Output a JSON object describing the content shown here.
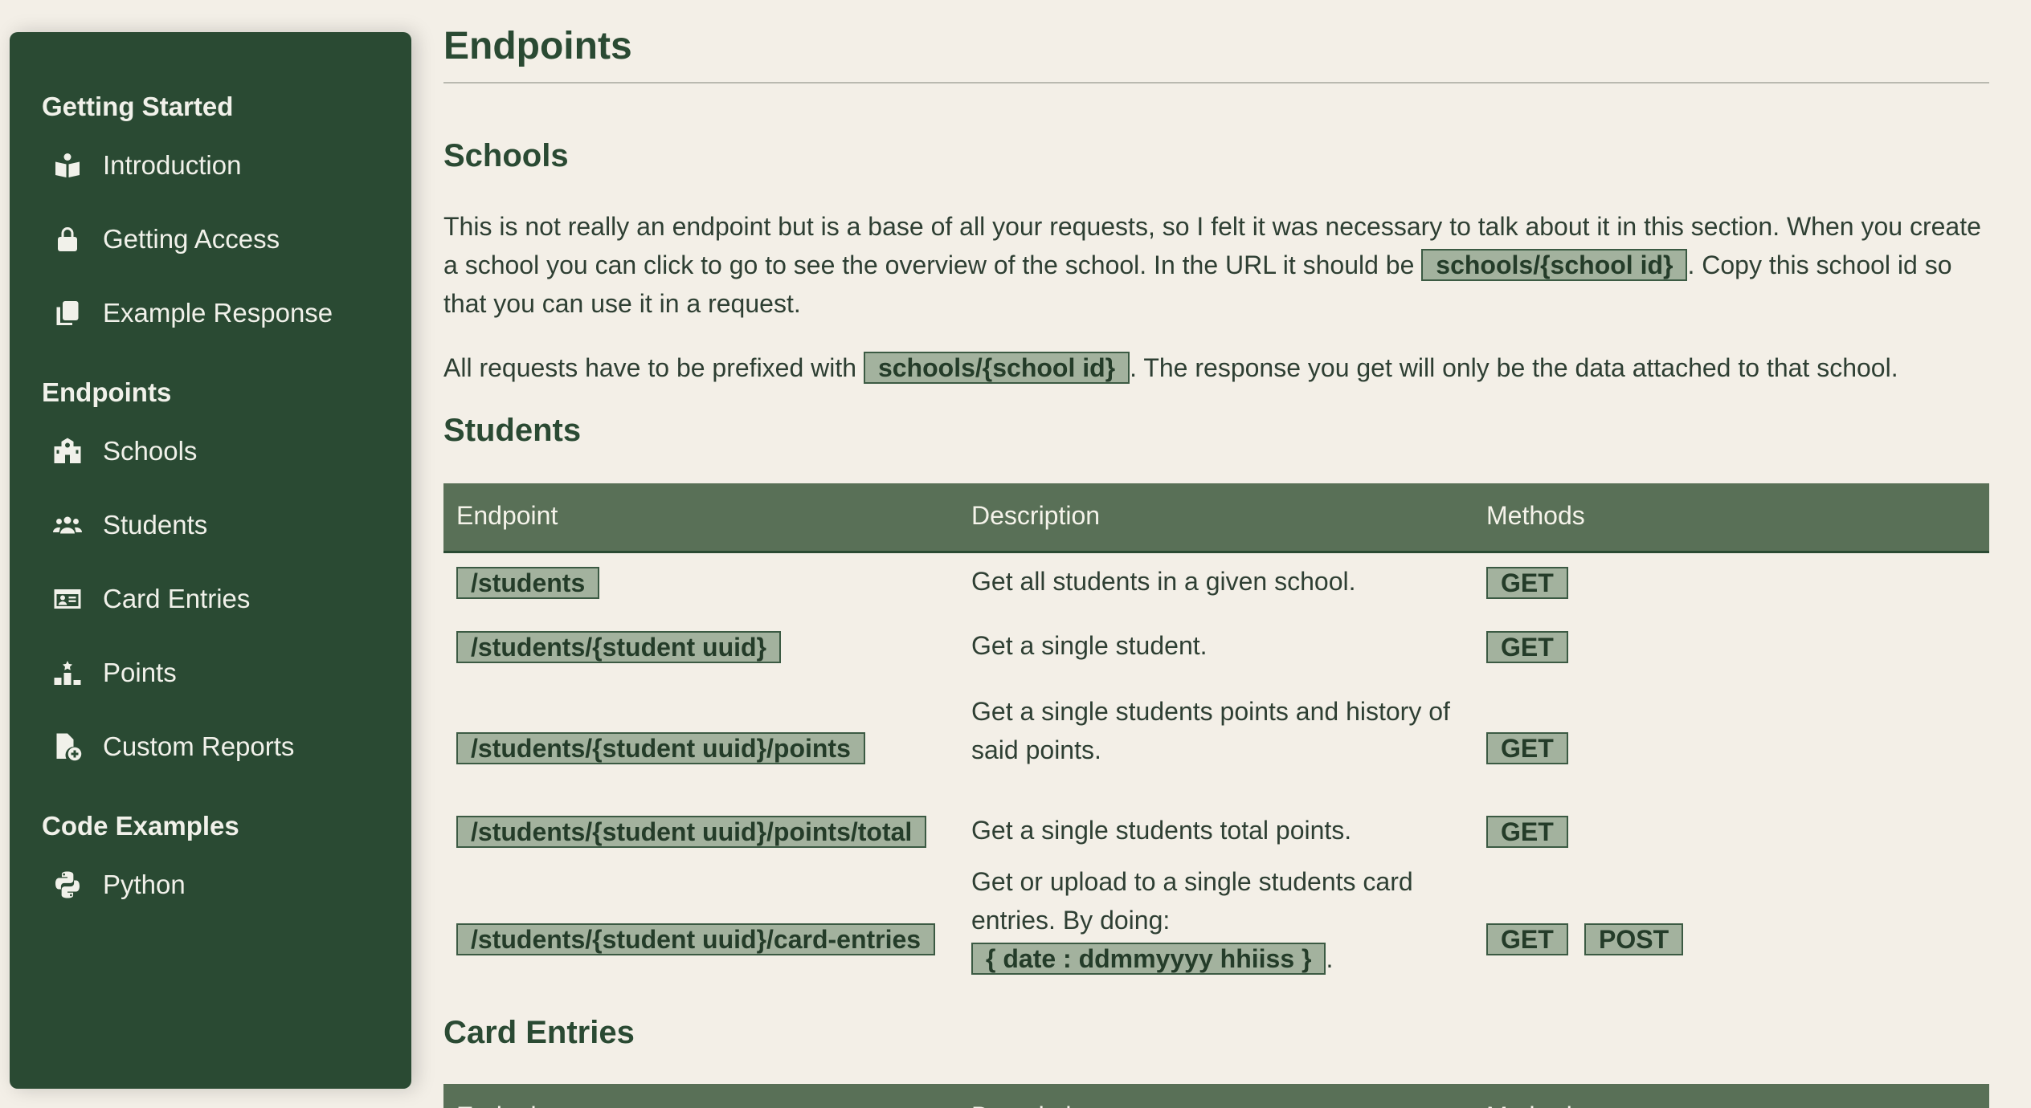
{
  "sidebar": {
    "sections": [
      {
        "title": "Getting Started",
        "items": [
          {
            "label": "Introduction",
            "icon": "book-reader-icon"
          },
          {
            "label": "Getting Access",
            "icon": "lock-icon"
          },
          {
            "label": "Example Response",
            "icon": "copy-icon"
          }
        ]
      },
      {
        "title": "Endpoints",
        "items": [
          {
            "label": "Schools",
            "icon": "school-icon"
          },
          {
            "label": "Students",
            "icon": "users-icon"
          },
          {
            "label": "Card Entries",
            "icon": "id-card-icon"
          },
          {
            "label": "Points",
            "icon": "ranking-icon"
          },
          {
            "label": "Custom Reports",
            "icon": "file-plus-icon"
          }
        ]
      },
      {
        "title": "Code Examples",
        "items": [
          {
            "label": "Python",
            "icon": "python-icon"
          }
        ]
      }
    ]
  },
  "main": {
    "title": "Endpoints",
    "schools": {
      "heading": "Schools",
      "p1_a": "This is not really an endpoint but is a base of all your requests, so I felt it was necessary to talk about it in this section. When you create a school you can click to go to see the overview of the school. In the URL it should be ",
      "p1_code": "schools/{school id}",
      "p1_b": ". Copy this school id so that you can use it in a request.",
      "p2_a": "All requests have to be prefixed with ",
      "p2_code": "schools/{school id}",
      "p2_b": ". The response you get will only be the data attached to that school."
    },
    "students": {
      "heading": "Students",
      "columns": [
        "Endpoint",
        "Description",
        "Methods"
      ],
      "rows": [
        {
          "endpoint": "/students",
          "description": "Get all students in a given school.",
          "methods": [
            "GET"
          ]
        },
        {
          "endpoint": "/students/{student uuid}",
          "description": "Get a single student.",
          "methods": [
            "GET"
          ]
        },
        {
          "endpoint": "/students/{student uuid}/points",
          "description": "Get a single students points and history of said points.",
          "methods": [
            "GET"
          ]
        },
        {
          "endpoint": "/students/{student uuid}/points/total",
          "description": "Get a single students total points.",
          "methods": [
            "GET"
          ]
        },
        {
          "endpoint": "/students/{student uuid}/card-entries",
          "description": "Get or upload to a single students card entries. By doing:",
          "description_code": "{ date : ddmmyyyy hhiiss }",
          "description_tail": ".",
          "methods": [
            "GET",
            "POST"
          ]
        }
      ]
    },
    "card_entries": {
      "heading": "Card Entries",
      "columns": [
        "Endpoint",
        "Description",
        "Methods"
      ]
    }
  },
  "colors": {
    "sidebar_bg": "#2a4a33",
    "page_bg": "#f3efe7",
    "table_header_bg": "#597057",
    "code_bg": "#a3b29e"
  }
}
